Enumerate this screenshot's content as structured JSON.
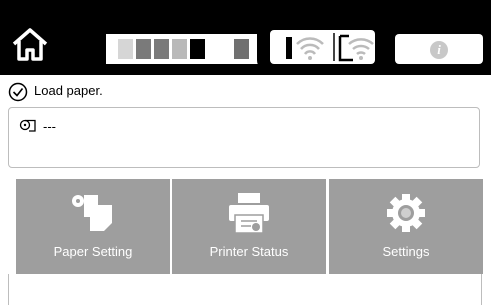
{
  "header": {
    "home_icon": "home-icon",
    "ink_colors": [
      "#ffffff",
      "#d6d6d6",
      "#7a7a7a",
      "#7a7a7a",
      "#b9b9b9",
      "#000000",
      "#ffffff",
      "#707070"
    ],
    "connection_icons": [
      "wired-lan-icon",
      "wifi-direct-icon"
    ],
    "info_icon": "i"
  },
  "status": {
    "message": "Load paper."
  },
  "paper_info": {
    "value": "---"
  },
  "tiles": [
    {
      "label": "Paper Setting",
      "icon": "paper-setting-icon"
    },
    {
      "label": "Printer Status",
      "icon": "printer-icon"
    },
    {
      "label": "Settings",
      "icon": "gear-icon"
    }
  ]
}
